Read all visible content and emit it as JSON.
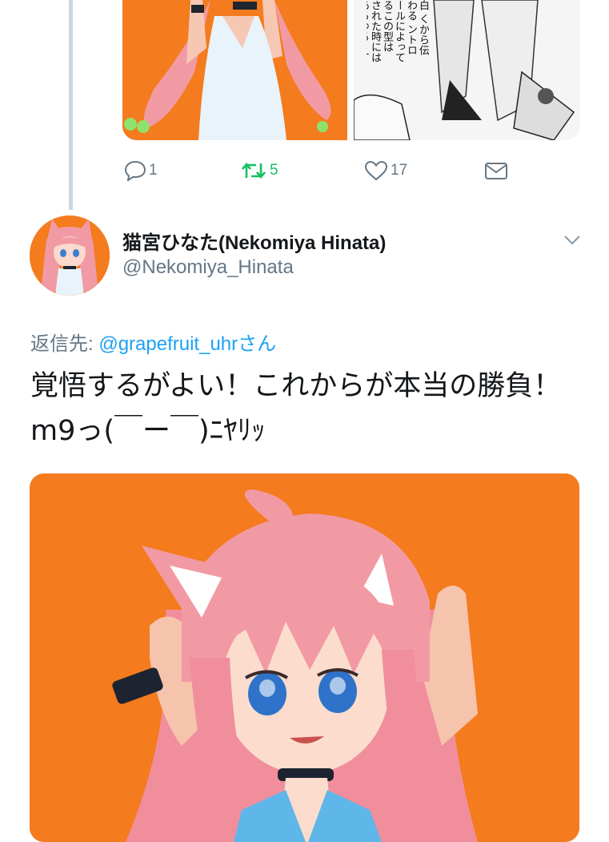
{
  "previous_tweet": {
    "manga_text": "白\nくから伝わる\nントロールによって\nるこの型は\nされた時には　あらゆる\nえると言われる",
    "actions": {
      "reply_count": "1",
      "retweet_count": "5",
      "like_count": "17"
    }
  },
  "tweet": {
    "display_name": "猫宮ひなた(Nekomiya Hinata)",
    "handle": "@Nekomiya_Hinata",
    "reply_prefix": "返信先: ",
    "reply_mention": "@grapefruit_uhrさん",
    "text": "覚悟するがよい！これからが本当の勝負！m9っ(￣ー￣)ﾆﾔﾘｯ"
  },
  "colors": {
    "brand_blue": "#1da1f2",
    "retweet_green": "#17bf63",
    "muted_gray": "#657786",
    "media_orange": "#f47b1e"
  },
  "icons": {
    "reply": "reply-icon",
    "retweet": "retweet-icon",
    "like": "heart-icon",
    "dm": "envelope-icon",
    "more": "chevron-down-icon"
  }
}
